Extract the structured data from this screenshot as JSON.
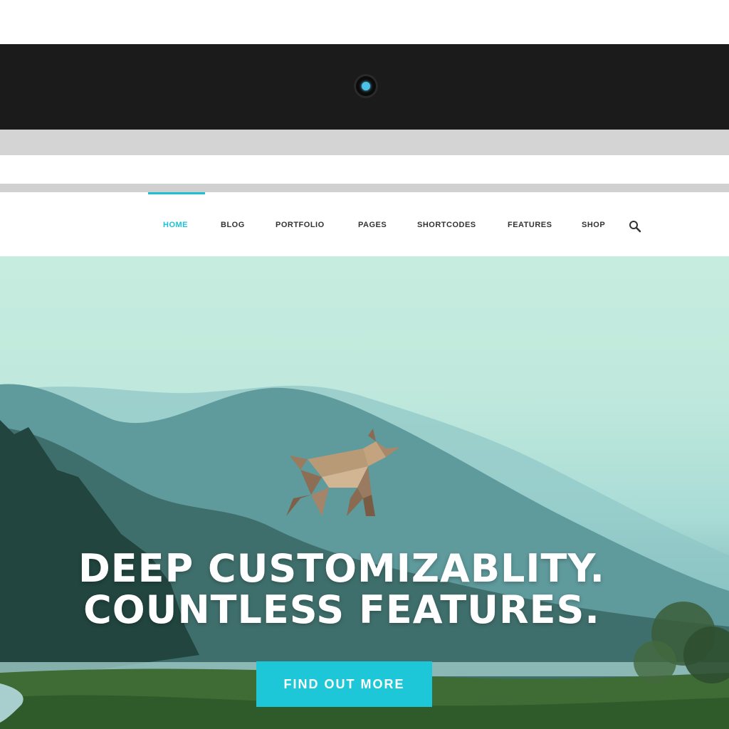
{
  "nav": {
    "items": [
      {
        "label": "HOME",
        "active": true
      },
      {
        "label": "BLOG",
        "active": false
      },
      {
        "label": "PORTFOLIO",
        "active": false
      },
      {
        "label": "PAGES",
        "active": false
      },
      {
        "label": "SHORTCODES",
        "active": false
      },
      {
        "label": "FEATURES",
        "active": false
      },
      {
        "label": "SHOP",
        "active": false
      }
    ],
    "search_icon": "search-icon"
  },
  "hero": {
    "title_line1": "DEEP CUSTOMIZABLITY.",
    "title_line2": "COUNTLESS FEATURES.",
    "cta_label": "FIND OUT MORE",
    "logo_icon": "origami-dog-logo"
  },
  "colors": {
    "accent": "#1ec0d6",
    "bezel": "#1b1b1b",
    "nav_text": "#333333",
    "hero_text": "#ffffff"
  }
}
